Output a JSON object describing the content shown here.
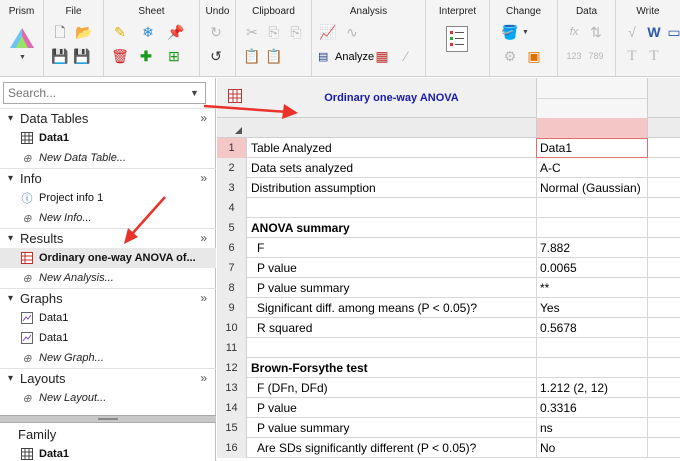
{
  "ribbon": {
    "groups": [
      "Prism",
      "File",
      "Sheet",
      "Undo",
      "Clipboard",
      "Analysis",
      "Interpret",
      "Change",
      "Data",
      "Write"
    ],
    "analyze_label": "Analyze"
  },
  "navigator": {
    "search_placeholder": "Search...",
    "sections": {
      "data_tables": {
        "title": "Data Tables",
        "items": [
          "Data1"
        ],
        "new": "New Data Table..."
      },
      "info": {
        "title": "Info",
        "items": [
          "Project info 1"
        ],
        "new": "New Info..."
      },
      "results": {
        "title": "Results",
        "items": [
          "Ordinary one-way ANOVA of..."
        ],
        "new": "New Analysis..."
      },
      "graphs": {
        "title": "Graphs",
        "items": [
          "Data1",
          "Data1"
        ],
        "new": "New Graph..."
      },
      "layouts": {
        "title": "Layouts",
        "new": "New Layout..."
      },
      "family": {
        "title": "Family",
        "items": [
          "Data1"
        ]
      }
    }
  },
  "sheet": {
    "title": "Ordinary one-way ANOVA",
    "rows": [
      {
        "n": "1",
        "label": "Table Analyzed",
        "value": "Data1"
      },
      {
        "n": "2",
        "label": "Data sets analyzed",
        "value": "A-C"
      },
      {
        "n": "3",
        "label": "Distribution assumption",
        "value": "Normal (Gaussian)"
      },
      {
        "n": "4",
        "label": "",
        "value": ""
      },
      {
        "n": "5",
        "label": "ANOVA summary",
        "value": ""
      },
      {
        "n": "6",
        "label": "F",
        "value": "7.882"
      },
      {
        "n": "7",
        "label": "P value",
        "value": "0.0065"
      },
      {
        "n": "8",
        "label": "P value summary",
        "value": "**"
      },
      {
        "n": "9",
        "label": "Significant diff. among means (P < 0.05)?",
        "value": "Yes"
      },
      {
        "n": "10",
        "label": "R squared",
        "value": "0.5678"
      },
      {
        "n": "11",
        "label": "",
        "value": ""
      },
      {
        "n": "12",
        "label": "Brown-Forsythe test",
        "value": ""
      },
      {
        "n": "13",
        "label": "F (DFn, DFd)",
        "value": "1.212 (2, 12)"
      },
      {
        "n": "14",
        "label": "P value",
        "value": "0.3316"
      },
      {
        "n": "15",
        "label": "P value summary",
        "value": "ns"
      },
      {
        "n": "16",
        "label": "Are SDs significantly different (P < 0.05)?",
        "value": "No"
      }
    ]
  },
  "colors": {
    "accent_red": "#e8322a",
    "title_blue": "#1a1aa8",
    "selected_col": "#f4c6c6"
  }
}
